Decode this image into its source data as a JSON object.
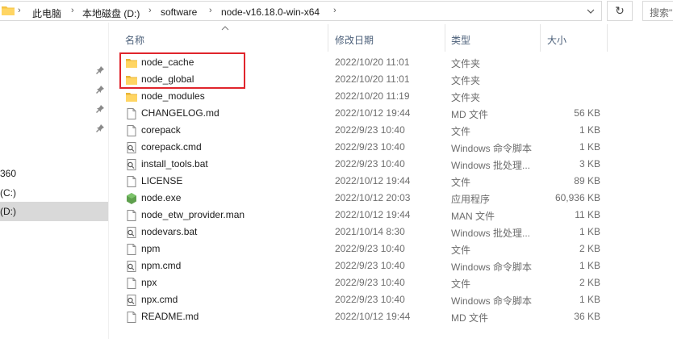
{
  "address": {
    "crumbs": [
      "此电脑",
      "本地磁盘 (D:)",
      "software",
      "node-v16.18.0-win-x64"
    ],
    "separator": "›",
    "dropdown_icon": "chevron-down-icon",
    "refresh_glyph": "↻",
    "search_placeholder": "搜索\""
  },
  "nav": {
    "items": [
      {
        "label": " 360"
      },
      {
        "label": "(C:)"
      },
      {
        "label": "(D:)",
        "selected": true
      }
    ]
  },
  "columns": {
    "name": "名称",
    "date": "修改日期",
    "type": "类型",
    "size": "大小"
  },
  "files": [
    {
      "name": "node_cache",
      "date": "2022/10/20 11:01",
      "type": "文件夹",
      "size": "",
      "icon": "folder"
    },
    {
      "name": "node_global",
      "date": "2022/10/20 11:01",
      "type": "文件夹",
      "size": "",
      "icon": "folder"
    },
    {
      "name": "node_modules",
      "date": "2022/10/20 11:19",
      "type": "文件夹",
      "size": "",
      "icon": "folder"
    },
    {
      "name": "CHANGELOG.md",
      "date": "2022/10/12 19:44",
      "type": "MD 文件",
      "size": "56 KB",
      "icon": "file"
    },
    {
      "name": "corepack",
      "date": "2022/9/23 10:40",
      "type": "文件",
      "size": "1 KB",
      "icon": "file"
    },
    {
      "name": "corepack.cmd",
      "date": "2022/9/23 10:40",
      "type": "Windows 命令脚本",
      "size": "1 KB",
      "icon": "script"
    },
    {
      "name": "install_tools.bat",
      "date": "2022/9/23 10:40",
      "type": "Windows 批处理...",
      "size": "3 KB",
      "icon": "script"
    },
    {
      "name": "LICENSE",
      "date": "2022/10/12 19:44",
      "type": "文件",
      "size": "89 KB",
      "icon": "file"
    },
    {
      "name": "node.exe",
      "date": "2022/10/12 20:03",
      "type": "应用程序",
      "size": "60,936 KB",
      "icon": "node"
    },
    {
      "name": "node_etw_provider.man",
      "date": "2022/10/12 19:44",
      "type": "MAN 文件",
      "size": "11 KB",
      "icon": "file"
    },
    {
      "name": "nodevars.bat",
      "date": "2021/10/14 8:30",
      "type": "Windows 批处理...",
      "size": "1 KB",
      "icon": "script"
    },
    {
      "name": "npm",
      "date": "2022/9/23 10:40",
      "type": "文件",
      "size": "2 KB",
      "icon": "file"
    },
    {
      "name": "npm.cmd",
      "date": "2022/9/23 10:40",
      "type": "Windows 命令脚本",
      "size": "1 KB",
      "icon": "script"
    },
    {
      "name": "npx",
      "date": "2022/9/23 10:40",
      "type": "文件",
      "size": "2 KB",
      "icon": "file"
    },
    {
      "name": "npx.cmd",
      "date": "2022/9/23 10:40",
      "type": "Windows 命令脚本",
      "size": "1 KB",
      "icon": "script"
    },
    {
      "name": "README.md",
      "date": "2022/10/12 19:44",
      "type": "MD 文件",
      "size": "36 KB",
      "icon": "file"
    }
  ],
  "colors": {
    "highlight_border": "#e0252c",
    "folder": "#f5c342",
    "header_text": "#4c607a",
    "selected_nav": "#d9d9d9"
  }
}
